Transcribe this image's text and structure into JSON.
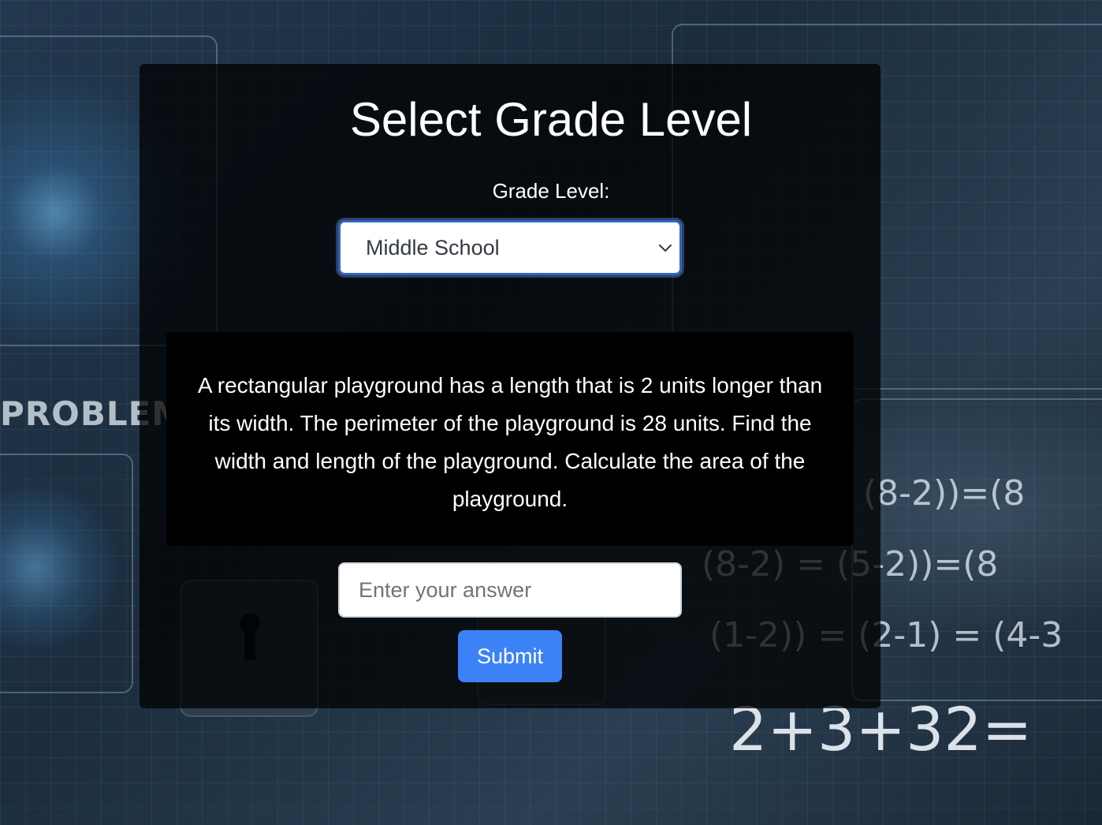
{
  "page": {
    "title": "Select Grade Level"
  },
  "grade": {
    "label": "Grade Level:",
    "selected": "Middle School"
  },
  "problem": {
    "text": "A rectangular playground has a length that is 2 units longer than its width. The perimeter of the playground is 28 units. Find the width and length of the playground. Calculate the area of the playground."
  },
  "answer": {
    "placeholder": "Enter your answer",
    "value": ""
  },
  "submit": {
    "label": "Submit"
  },
  "background": {
    "decorations": {
      "problems_word": "PROBLEMS",
      "big_equation": "2+3+32=",
      "eq1": "(8-2))=(8",
      "eq2": "(8-2) = (5-2))=(8",
      "eq3": "(1-2)) = (2-1) = (4-3"
    }
  },
  "colors": {
    "accent": "#3b82f6",
    "card_bg": "rgba(0,0,0,0.74)",
    "problem_bg": "#000000",
    "select_border": "#2f64c4"
  }
}
